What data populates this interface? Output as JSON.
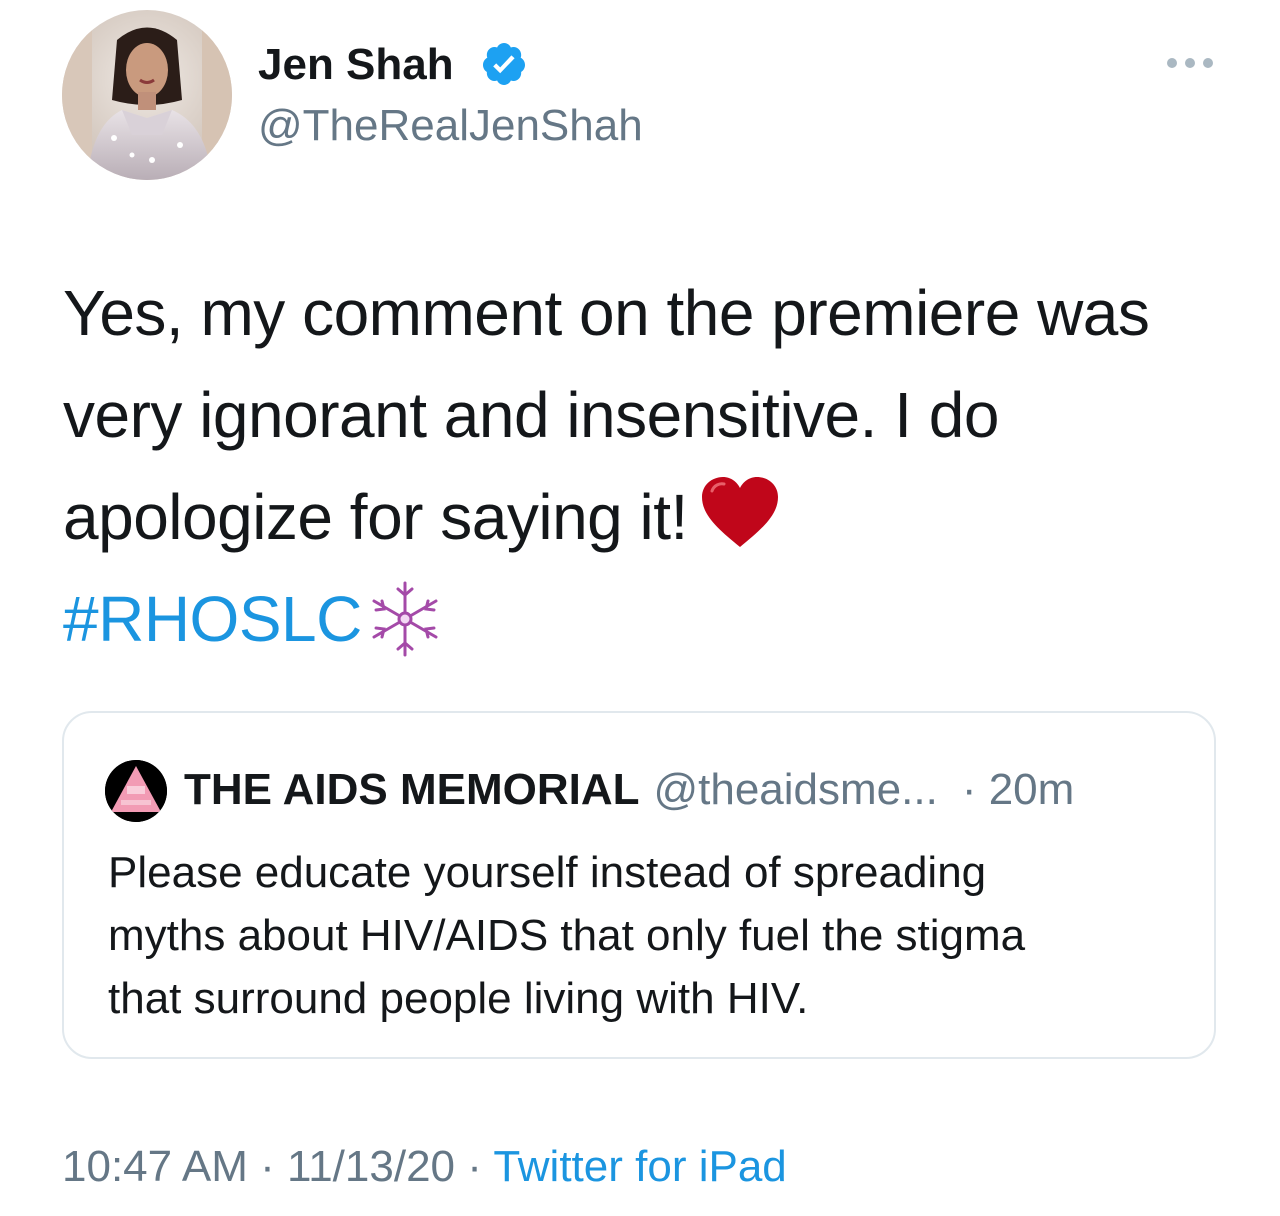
{
  "author": {
    "name": "Jen Shah",
    "handle": "@TheRealJenShah",
    "verified": true,
    "avatar_icon": "profile-photo"
  },
  "tweet": {
    "lines": [
      "Yes, my comment on the premiere was",
      "very ignorant and insensitive. I do",
      "apologize for saying it!"
    ],
    "heart_emoji": "red-heart-icon",
    "hashtag": "#RHOSLC",
    "hashtag_emoji": "snowflake-icon"
  },
  "quoted": {
    "name": "THE AIDS MEMORIAL",
    "handle": "@theaidsme...",
    "time": "· 20m",
    "lines": [
      "Please educate yourself instead of spreading",
      "myths about HIV/AIDS that only fuel the stigma",
      "that surround people living with HIV."
    ]
  },
  "meta": {
    "timestamp": "10:47 AM · 11/13/20 · ",
    "source": "Twitter for iPad"
  },
  "colors": {
    "link": "#1b95e0",
    "secondary_text": "#657786",
    "border": "#e1e8ed",
    "verified_badge": "#1da1f2"
  }
}
